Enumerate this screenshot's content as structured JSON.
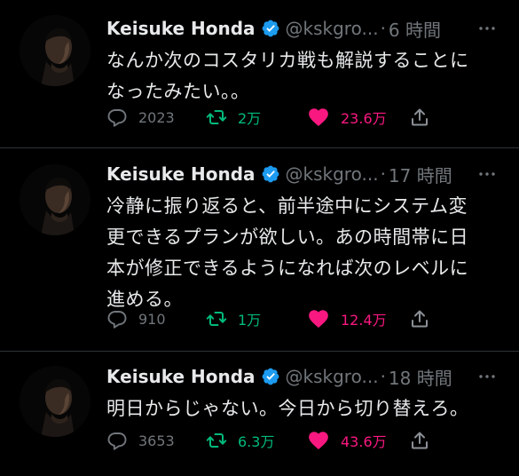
{
  "colors": {
    "background": "#000000",
    "text": "#e7e9ea",
    "muted": "#71767b",
    "verified": "#1d9bf0",
    "retweet": "#00ba7c",
    "like": "#f91880",
    "divider": "#2f3336"
  },
  "tweets": [
    {
      "name": "Keisuke Honda",
      "handle": "@kskgro...",
      "dot": "·",
      "time": "6 時間",
      "text": "なんか次のコスタリカ戦も解説することに\nなったみたい。。",
      "replies": "2023",
      "retweets": "2万",
      "likes": "23.6万",
      "icons": [
        "avatar",
        "verified-badge-icon",
        "more-icon",
        "reply-icon",
        "retweet-icon",
        "like-icon",
        "share-icon"
      ]
    },
    {
      "name": "Keisuke Honda",
      "handle": "@kskgro...",
      "dot": "·",
      "time": "17 時間",
      "text": "冷静に振り返ると、前半途中にシステム変\n更できるプランが欲しい。あの時間帯に日\n本が修正できるようになれば次のレベルに\n進める。",
      "replies": "910",
      "retweets": "1万",
      "likes": "12.4万",
      "icons": [
        "avatar",
        "verified-badge-icon",
        "more-icon",
        "reply-icon",
        "retweet-icon",
        "like-icon",
        "share-icon"
      ]
    },
    {
      "name": "Keisuke Honda",
      "handle": "@kskgro...",
      "dot": "·",
      "time": "18 時間",
      "text": "明日からじゃない。今日から切り替えろ。",
      "replies": "3653",
      "retweets": "6.3万",
      "likes": "43.6万",
      "icons": [
        "avatar",
        "verified-badge-icon",
        "more-icon",
        "reply-icon",
        "retweet-icon",
        "like-icon",
        "share-icon"
      ]
    }
  ]
}
